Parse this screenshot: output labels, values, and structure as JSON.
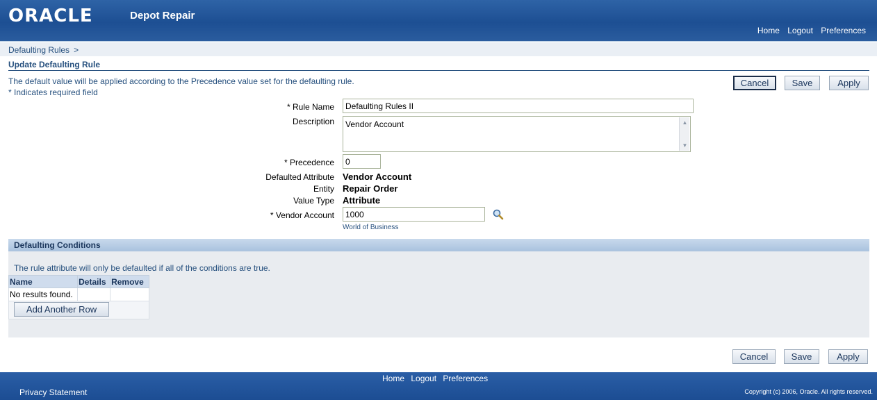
{
  "header": {
    "logo": "ORACLE",
    "product": "Depot Repair",
    "links": [
      "Home",
      "Logout",
      "Preferences"
    ]
  },
  "breadcrumb": {
    "link": "Defaulting Rules",
    "separator": ">"
  },
  "page": {
    "title": "Update Defaulting Rule",
    "instruction": "The default value will be applied according to the Precedence value set for the defaulting rule.",
    "required_note": "* Indicates required field"
  },
  "buttons": {
    "cancel": "Cancel",
    "save": "Save",
    "apply": "Apply"
  },
  "form": {
    "rule_name": {
      "label": "* Rule Name",
      "value": "Defaulting Rules II"
    },
    "description": {
      "label": "Description",
      "value": "Vendor Account"
    },
    "precedence": {
      "label": "* Precedence",
      "value": "0"
    },
    "defaulted_attribute": {
      "label": "Defaulted Attribute",
      "value": "Vendor Account"
    },
    "entity": {
      "label": "Entity",
      "value": "Repair Order"
    },
    "value_type": {
      "label": "Value Type",
      "value": "Attribute"
    },
    "vendor_account": {
      "label": "* Vendor Account",
      "value": "1000",
      "hint": "World of Business"
    }
  },
  "conditions": {
    "title": "Defaulting Conditions",
    "description": "The rule attribute will only be defaulted if all of the conditions are true.",
    "columns": [
      "Name",
      "Details",
      "Remove"
    ],
    "empty_text": "No results found.",
    "add_row_label": "Add Another Row"
  },
  "footer": {
    "links": [
      "Home",
      "Logout",
      "Preferences"
    ],
    "privacy": "Privacy Statement",
    "copyright": "Copyright (c) 2006, Oracle. All rights reserved."
  },
  "colors": {
    "brand_blue": "#1d4f93",
    "link_blue": "#26507e",
    "section_bg": "#e9ecf0"
  }
}
